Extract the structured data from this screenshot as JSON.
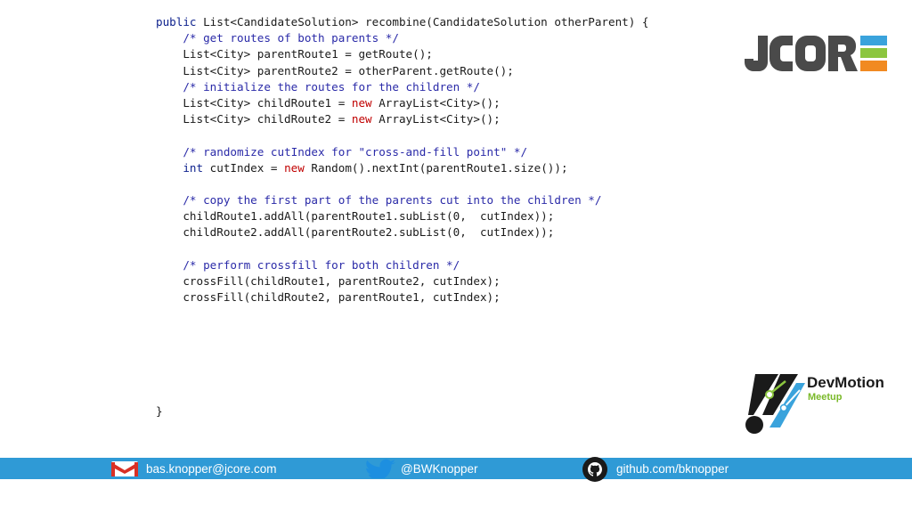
{
  "code": {
    "lines": [
      [
        {
          "t": "public ",
          "c": "kw"
        },
        {
          "t": "List<CandidateSolution> recombine(CandidateSolution otherParent) {"
        }
      ],
      [
        {
          "t": "    "
        },
        {
          "t": "/* get routes of both parents */",
          "c": "cm"
        }
      ],
      [
        {
          "t": "    List<City> parentRoute1 = getRoute();"
        }
      ],
      [
        {
          "t": "    List<City> parentRoute2 = otherParent.getRoute();"
        }
      ],
      [
        {
          "t": "    "
        },
        {
          "t": "/* initialize the routes for the children */",
          "c": "cm"
        }
      ],
      [
        {
          "t": "    List<City> childRoute1 = "
        },
        {
          "t": "new",
          "c": "nw"
        },
        {
          "t": " ArrayList<City>();"
        }
      ],
      [
        {
          "t": "    List<City> childRoute2 = "
        },
        {
          "t": "new",
          "c": "nw"
        },
        {
          "t": " ArrayList<City>();"
        }
      ],
      [
        {
          "t": ""
        }
      ],
      [
        {
          "t": "    "
        },
        {
          "t": "/* randomize cutIndex for \"cross-and-fill point\" */",
          "c": "cm"
        }
      ],
      [
        {
          "t": "    "
        },
        {
          "t": "int",
          "c": "kw"
        },
        {
          "t": " cutIndex = "
        },
        {
          "t": "new",
          "c": "nw"
        },
        {
          "t": " Random().nextInt(parentRoute1.size());"
        }
      ],
      [
        {
          "t": ""
        }
      ],
      [
        {
          "t": "    "
        },
        {
          "t": "/* copy the first part of the parents cut into the children */",
          "c": "cm"
        }
      ],
      [
        {
          "t": "    childRoute1.addAll(parentRoute1.subList(0,  cutIndex));"
        }
      ],
      [
        {
          "t": "    childRoute2.addAll(parentRoute2.subList(0,  cutIndex));"
        }
      ],
      [
        {
          "t": ""
        }
      ],
      [
        {
          "t": "    "
        },
        {
          "t": "/* perform crossfill for both children */",
          "c": "cm"
        }
      ],
      [
        {
          "t": "    crossFill(childRoute1, parentRoute2, cutIndex);"
        }
      ],
      [
        {
          "t": "    crossFill(childRoute2, parentRoute1, cutIndex);"
        }
      ],
      [
        {
          "t": ""
        }
      ],
      [
        {
          "t": ""
        }
      ],
      [
        {
          "t": ""
        }
      ],
      [
        {
          "t": ""
        }
      ],
      [
        {
          "t": ""
        }
      ],
      [
        {
          "t": ""
        }
      ],
      [
        {
          "t": "}"
        }
      ]
    ]
  },
  "logos": {
    "jcore": {
      "label": "JCORE",
      "colors": {
        "dark": "#4a4a4a",
        "orange": "#f18a21",
        "blue": "#3aa3dc",
        "green": "#8cc63f"
      }
    },
    "devmotion": {
      "title": "DevMotion",
      "subtitle": "Meetup",
      "colors": {
        "title": "#1a1a1a",
        "subtitle": "#7ab929",
        "accent": "#3aa3dc"
      }
    }
  },
  "footer": {
    "bg": "#2f9ad6",
    "email": {
      "icon": "gmail-icon",
      "text": "bas.knopper@jcore.com"
    },
    "twitter": {
      "icon": "twitter-icon",
      "text": "@BWKnopper"
    },
    "github": {
      "icon": "github-icon",
      "text": "github.com/bknopper"
    }
  }
}
